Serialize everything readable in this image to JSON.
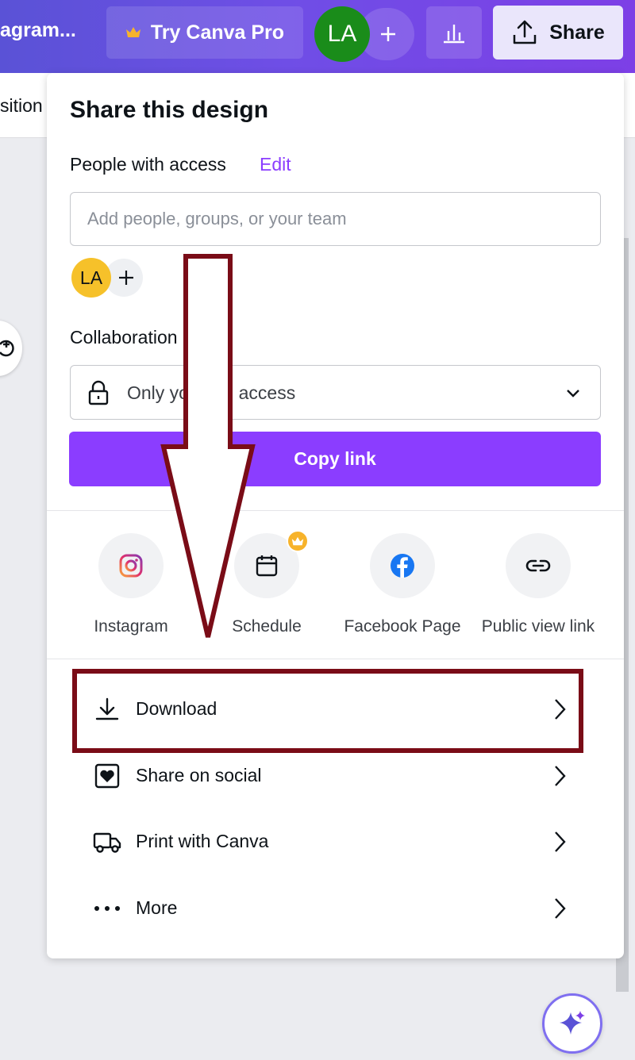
{
  "topbar": {
    "title": "agram...",
    "pro_label": "Try Canva Pro",
    "avatar_initials": "LA",
    "share_label": "Share"
  },
  "subbar": {
    "text": "sition"
  },
  "panel": {
    "title": "Share this design",
    "access_label": "People with access",
    "edit_label": "Edit",
    "input_placeholder": "Add people, groups, or your team",
    "member_initials": "LA",
    "collab_label": "Collaboration link",
    "access_select_value": "Only you can access",
    "copy_link_label": "Copy link",
    "share_options": [
      {
        "label": "Instagram",
        "icon": "instagram-icon"
      },
      {
        "label": "Schedule",
        "icon": "calendar-icon",
        "badge": "crown-icon"
      },
      {
        "label": "Facebook Page",
        "icon": "facebook-icon"
      },
      {
        "label": "Public view link",
        "icon": "link-icon"
      }
    ],
    "menu": [
      {
        "label": "Download",
        "icon": "download-icon"
      },
      {
        "label": "Share on social",
        "icon": "heart-frame-icon"
      },
      {
        "label": "Print with Canva",
        "icon": "truck-icon"
      },
      {
        "label": "More",
        "icon": "more-icon"
      }
    ]
  },
  "colors": {
    "accent": "#8b3dff",
    "annotation": "#7a0c17",
    "avatar_green": "#1a8c1a",
    "avatar_yellow": "#f6c12a"
  }
}
